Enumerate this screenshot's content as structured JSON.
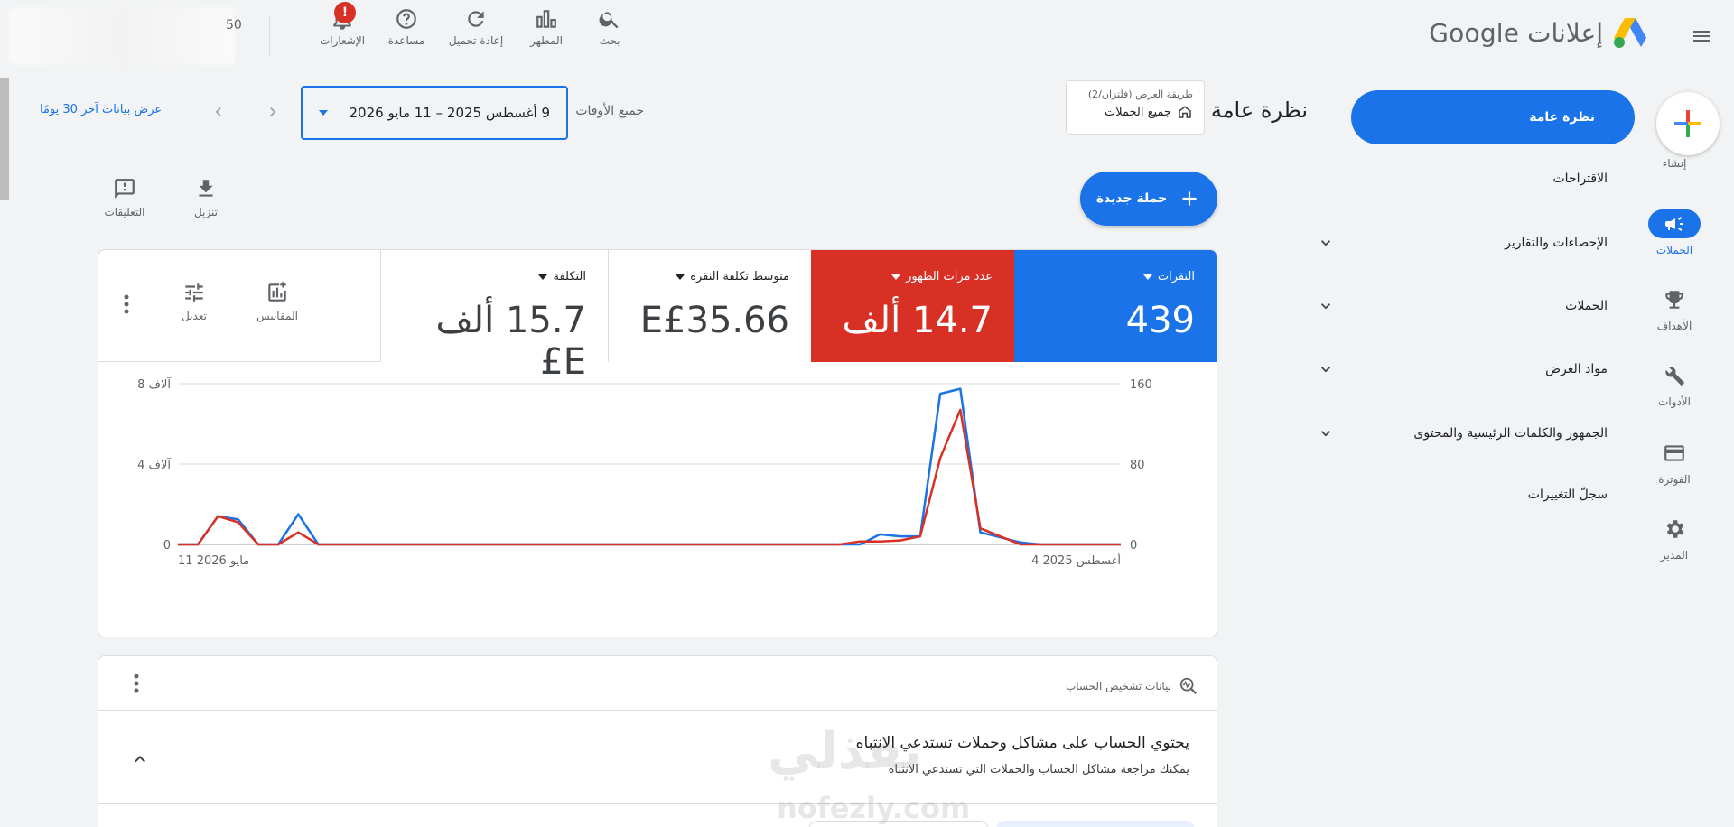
{
  "header": {
    "logo_text": "إعلانات Google",
    "blurred_value": "50",
    "icons": {
      "search": "بحث",
      "appearance": "المظهر",
      "refresh": "إعادة تحميل",
      "help": "مساعدة",
      "notifications": "الإشعارات"
    },
    "notification_badge": "!"
  },
  "rail": {
    "create": "إنشاء",
    "campaigns": "الحملات",
    "goals": "الأهداف",
    "tools": "الأدوات",
    "billing": "الفوترة",
    "admin": "المدير"
  },
  "nav": {
    "overview": "نظرة عامة",
    "items": [
      {
        "label": "الاقتراحات"
      },
      {
        "label": "الإحصاءات والتقارير"
      },
      {
        "label": "الحملات"
      },
      {
        "label": "مواد العرض"
      },
      {
        "label": "الجمهور والكلمات الرئيسية والمحتوى"
      },
      {
        "label": "سجلّ التغييرات"
      }
    ]
  },
  "toolbar": {
    "page_title": "نظرة عامة",
    "view_mode_label": "طريقة العرض (فلتزان/2)",
    "view_mode_value": "جميع الحملات",
    "date_preset": "جميع الأوقات",
    "date_range": "9 أغسطس 2025 – 11 مايو 2026",
    "last30": "عرض بيانات آخر 30 يومًا",
    "new_campaign": "حملة جديدة",
    "download": "تنزيل",
    "feedback": "التعليقات",
    "metrics_btn": "المقاييس",
    "adjust_btn": "تعديل"
  },
  "metrics": [
    {
      "label": "النقرات",
      "value": "439",
      "color": "#1a73e8"
    },
    {
      "label": "عدد مرات الظهور",
      "value": "14.7 ألف",
      "color": "#d93025"
    },
    {
      "label": "متوسط تكلفة النقرة",
      "value": "E£35.66"
    },
    {
      "label": "التكلفة",
      "value": "15.7 ألف E£"
    }
  ],
  "chart_data": {
    "type": "line",
    "x_start_label": "4 أغسطس 2025",
    "x_end_label": "11 مايو 2026",
    "y_left_ticks": [
      "0",
      "80",
      "160"
    ],
    "y_right_ticks": [
      "0",
      "4 آلاف",
      "8 آلاف"
    ],
    "y_left_lim": [
      0,
      160
    ],
    "y_right_lim": [
      0,
      8000
    ],
    "grid": true,
    "series": [
      {
        "name": "النقرات",
        "color": "#1a73e8",
        "axis": "left",
        "values": [
          0,
          0,
          0,
          0,
          0,
          2,
          7,
          12,
          155,
          150,
          8,
          8,
          10,
          0,
          0,
          0,
          0,
          0,
          0,
          0,
          0,
          0,
          0,
          0,
          0,
          0,
          0,
          0,
          0,
          0,
          0,
          0,
          0,
          0,
          0,
          0,
          0,
          0,
          0,
          0,
          0,
          30,
          0,
          0,
          25,
          28,
          0,
          0
        ]
      },
      {
        "name": "عدد مرات الظهور",
        "color": "#d93025",
        "axis": "right",
        "values": [
          0,
          0,
          0,
          0,
          0,
          0,
          400,
          800,
          6700,
          4300,
          400,
          200,
          150,
          150,
          0,
          0,
          0,
          0,
          0,
          0,
          0,
          0,
          0,
          0,
          0,
          0,
          0,
          0,
          0,
          0,
          0,
          0,
          0,
          0,
          0,
          0,
          0,
          0,
          0,
          0,
          0,
          600,
          0,
          0,
          1100,
          1400,
          0,
          0
        ]
      }
    ]
  },
  "diagnosis": {
    "header": "بيانات تشخيص الحساب",
    "title": "يحتوي الحساب على مشاكل وحملات تستدعي الانتباه",
    "subtitle": "يمكنك مراجعة مشاكل الحساب والحملات التي تستدعي الانتباه"
  },
  "watermark": {
    "arabic": "نفذلي",
    "latin": "nofezly.com"
  }
}
